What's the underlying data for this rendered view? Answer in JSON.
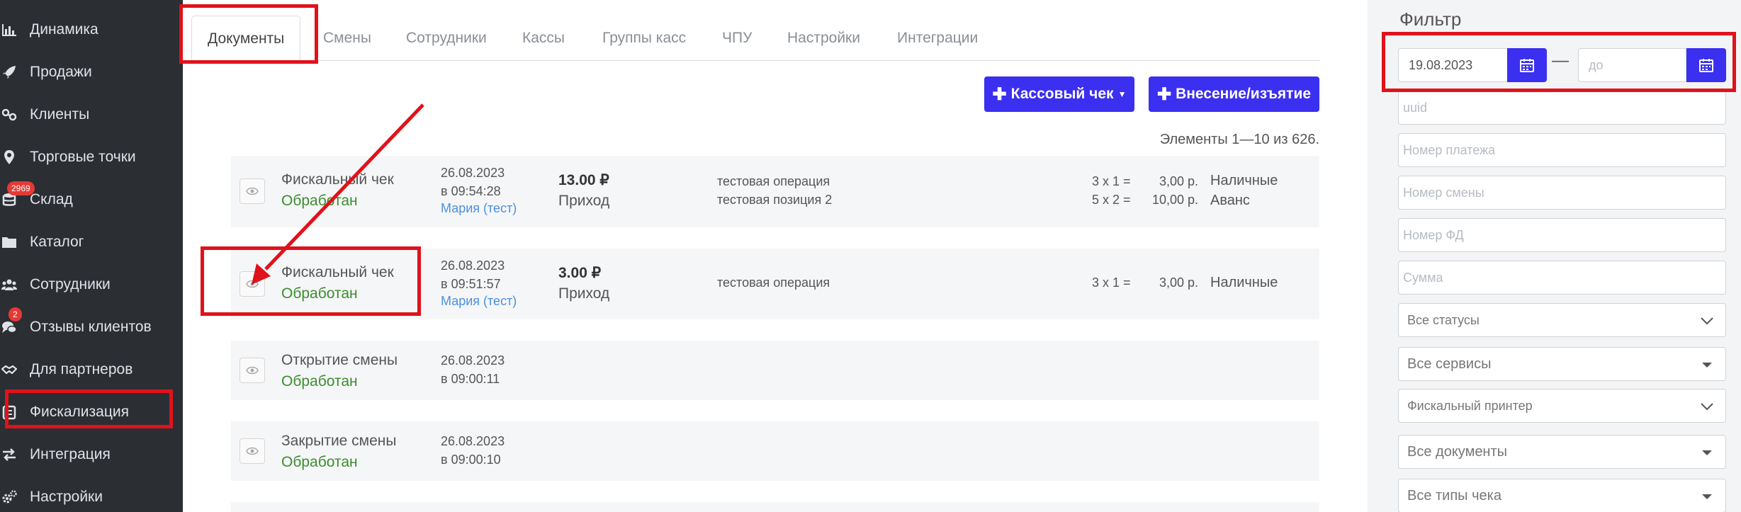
{
  "sidebar": {
    "items": [
      {
        "label": "Динамика",
        "icon": "bar-chart-icon"
      },
      {
        "label": "Продажи",
        "icon": "rocket-icon"
      },
      {
        "label": "Клиенты",
        "icon": "users-link-icon"
      },
      {
        "label": "Торговые точки",
        "icon": "map-marker-icon"
      },
      {
        "label": "Склад",
        "icon": "database-icon",
        "badge": "2969"
      },
      {
        "label": "Каталог",
        "icon": "folder-icon"
      },
      {
        "label": "Сотрудники",
        "icon": "group-icon"
      },
      {
        "label": "Отзывы клиентов",
        "icon": "comments-icon",
        "badge": "2"
      },
      {
        "label": "Для партнеров",
        "icon": "handshake-icon"
      },
      {
        "label": "Фискализация",
        "icon": "fiscal-icon"
      },
      {
        "label": "Интеграция",
        "icon": "exchange-icon"
      },
      {
        "label": "Настройки",
        "icon": "cogs-icon"
      }
    ]
  },
  "tabs": [
    "Документы",
    "Смены",
    "Сотрудники",
    "Кассы",
    "Группы касс",
    "ЧПУ",
    "Настройки",
    "Интеграции"
  ],
  "actions": {
    "receipt_label": "Кассовый чек",
    "cash_label": "Внесение/изъятие"
  },
  "counter": "Элементы 1—10 из 626.",
  "documents": [
    {
      "type": "Фискальный чек",
      "status": "Обработан",
      "date": "26.08.2023",
      "time": "в 09:54:28",
      "user": "Мария (тест)",
      "amount": "13.00 ₽",
      "kind": "Приход",
      "positions": [
        "тестовая операция",
        "тестовая позиция 2"
      ],
      "qty": [
        "3 x 1 =",
        "5 x 2 ="
      ],
      "sums": [
        "3,00 р.",
        "10,00 р."
      ],
      "payments": [
        "Наличные",
        "Аванс"
      ]
    },
    {
      "type": "Фискальный чек",
      "status": "Обработан",
      "date": "26.08.2023",
      "time": "в 09:51:57",
      "user": "Мария (тест)",
      "amount": "3.00 ₽",
      "kind": "Приход",
      "positions": [
        "тестовая операция"
      ],
      "qty": [
        "3 x 1 ="
      ],
      "sums": [
        "3,00 р."
      ],
      "payments": [
        "Наличные"
      ]
    },
    {
      "type": "Открытие смены",
      "status": "Обработан",
      "date": "26.08.2023",
      "time": "в 09:00:11"
    },
    {
      "type": "Закрытие смены",
      "status": "Обработан",
      "date": "26.08.2023",
      "time": "в 09:00:10"
    }
  ],
  "filter": {
    "title": "Фильтр",
    "date_from": "19.08.2023",
    "date_to_placeholder": "до",
    "dash": "—",
    "uuid_placeholder": "uuid",
    "payment_placeholder": "Номер платежа",
    "shift_placeholder": "Номер смены",
    "fd_placeholder": "Номер ФД",
    "sum_placeholder": "Сумма",
    "status_select": "Все статусы",
    "service_select": "Все сервисы",
    "printer_select": "Фискальный принтер",
    "docs_select": "Все документы",
    "receipt_type_select": "Все типы чека"
  },
  "colors": {
    "sidebar_bg": "#2b2e33",
    "accent": "#3b2ff0",
    "status_ok": "#3c8d2f",
    "highlight": "#e0121b"
  }
}
